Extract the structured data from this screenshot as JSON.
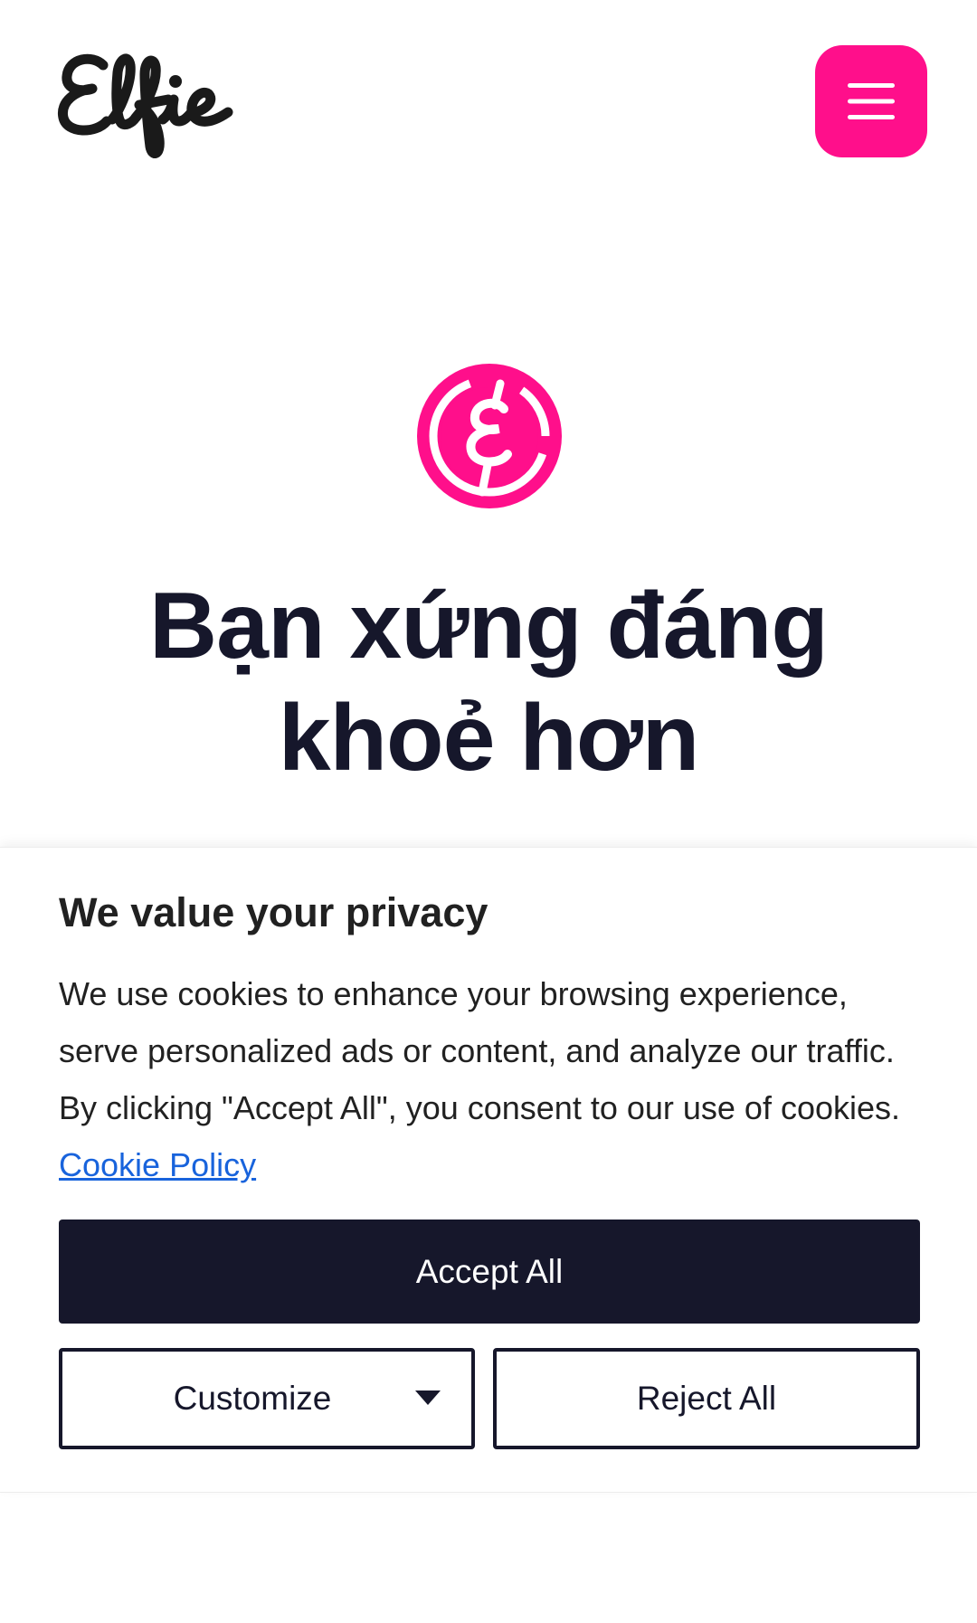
{
  "header": {
    "logo_text": "Elfie",
    "menu_icon": "hamburger-menu-icon",
    "brand_color": "#ff0f8b"
  },
  "hero": {
    "icon": "elfie-e-circle-icon",
    "title": "Bạn xứng đáng khoẻ hơn"
  },
  "cookie_banner": {
    "title": "We value your privacy",
    "text": "We use cookies to enhance your browsing experience, serve personalized ads or content, and analyze our traffic. By clicking \"Accept All\", you consent to our use of cookies.",
    "policy_link": "Cookie Policy",
    "accept_label": "Accept All",
    "customize_label": "Customize",
    "reject_label": "Reject All",
    "link_color": "#1863dc",
    "primary_color": "#16172b"
  }
}
